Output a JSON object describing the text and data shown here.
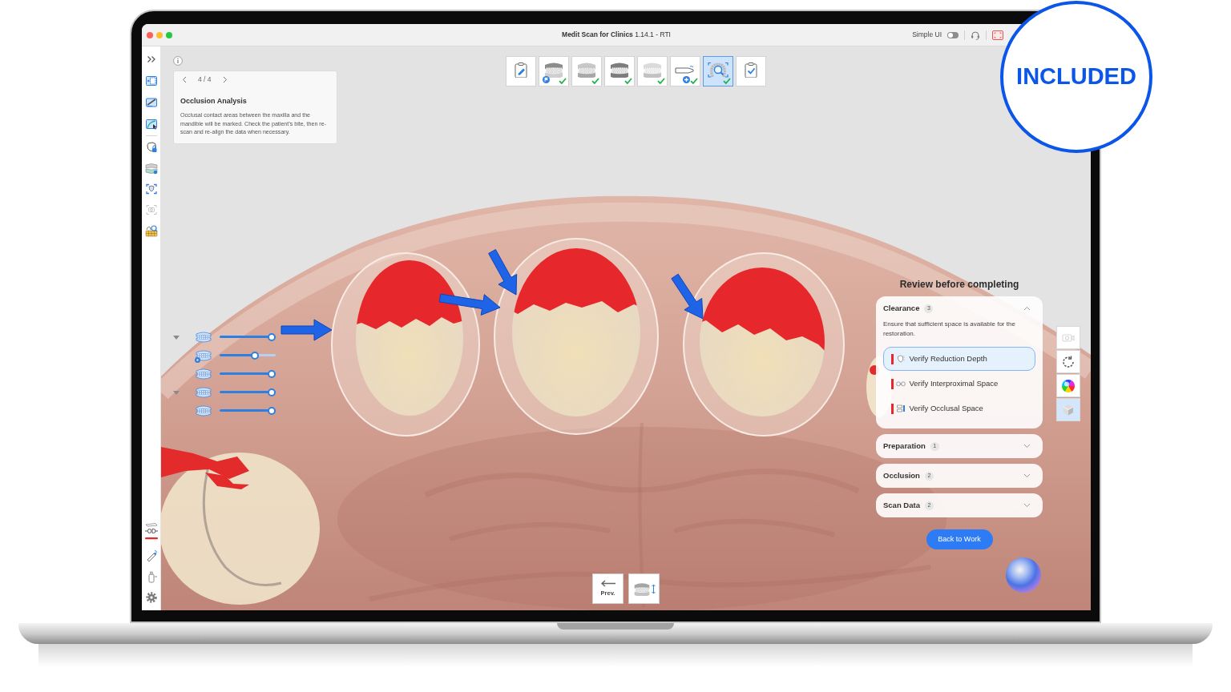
{
  "window": {
    "title": "**Medit Scan for Clinics** 1.14.1 - RTI",
    "simple_ui": {
      "label": "Simple UI",
      "on": false
    }
  },
  "sidebar": {
    "groups": [
      {
        "tools": [
          {
            "kind": "expand",
            "disabled": false
          },
          {
            "kind": "select",
            "disabled": false
          },
          {
            "kind": "trim",
            "disabled": false
          },
          {
            "kind": "fill",
            "disabled": false
          }
        ]
      },
      {
        "tools": [
          {
            "kind": "lock",
            "disabled": false
          },
          {
            "kind": "bite",
            "disabled": false
          },
          {
            "kind": "align",
            "disabled": false
          },
          {
            "kind": "capture",
            "disabled": true
          },
          {
            "kind": "analysis",
            "disabled": false
          }
        ]
      }
    ],
    "bottom_tools": [
      {
        "kind": "separate",
        "disabled": false
      },
      {
        "kind": "pen",
        "disabled": false
      },
      {
        "kind": "bottle",
        "disabled": false
      },
      {
        "kind": "settings",
        "disabled": false
      }
    ]
  },
  "guide": {
    "page": "4 / 4",
    "title": "Occlusion Analysis",
    "text": "Occlusal contact areas between the maxilla and the mandible will be marked. Check the patient’s bite, then re-scan and re-align the data when necessary."
  },
  "steps": [
    {
      "kind": "form",
      "done": false,
      "selected": false
    },
    {
      "kind": "maxilla",
      "done": true,
      "selected": false
    },
    {
      "kind": "mandible",
      "done": true,
      "selected": false
    },
    {
      "kind": "occlusion",
      "done": true,
      "selected": false
    },
    {
      "kind": "preop",
      "done": true,
      "selected": false
    },
    {
      "kind": "scanbody",
      "done": true,
      "selected": false
    },
    {
      "kind": "analysis",
      "done": true,
      "selected": true
    },
    {
      "kind": "complete",
      "done": false,
      "selected": false
    }
  ],
  "layers": [
    {
      "expanded": true,
      "level": 1,
      "flagged": false,
      "children": [
        {
          "level": 0.65,
          "flagged": true
        },
        {
          "level": 1,
          "flagged": false
        }
      ]
    },
    {
      "expanded": true,
      "level": 1,
      "flagged": false,
      "children": [
        {
          "level": 1,
          "flagged": false
        }
      ]
    }
  ],
  "review": {
    "title": "Review before completing",
    "sections": [
      {
        "title": "Clearance",
        "count": "3",
        "expanded": true,
        "description": "Ensure that sufficient space is available for the restoration.",
        "items": [
          {
            "kind": "depth",
            "label": "Verify Reduction Depth",
            "selected": true,
            "color": "#e8262b"
          },
          {
            "kind": "interproximal",
            "label": "Verify Interproximal Space",
            "selected": false,
            "color": "#e8262b"
          },
          {
            "kind": "occlusal",
            "label": "Verify Occlusal Space",
            "selected": false,
            "color": "#e8262b"
          }
        ]
      },
      {
        "title": "Preparation",
        "count": "1",
        "expanded": false
      },
      {
        "title": "Occlusion",
        "count": "2",
        "expanded": false
      },
      {
        "title": "Scan Data",
        "count": "2",
        "expanded": false
      }
    ],
    "button": "Back to Work"
  },
  "view_tools": [
    {
      "kind": "camera",
      "selected": false,
      "disabled": true
    },
    {
      "kind": "rotate",
      "selected": false,
      "disabled": false
    },
    {
      "kind": "color",
      "selected": false,
      "disabled": false
    },
    {
      "kind": "cube",
      "selected": true,
      "disabled": false
    }
  ],
  "bottom_buttons": [
    {
      "kind": "prev",
      "label": "Prev."
    },
    {
      "kind": "bite"
    }
  ],
  "badge": {
    "text": "INCLUDED"
  }
}
